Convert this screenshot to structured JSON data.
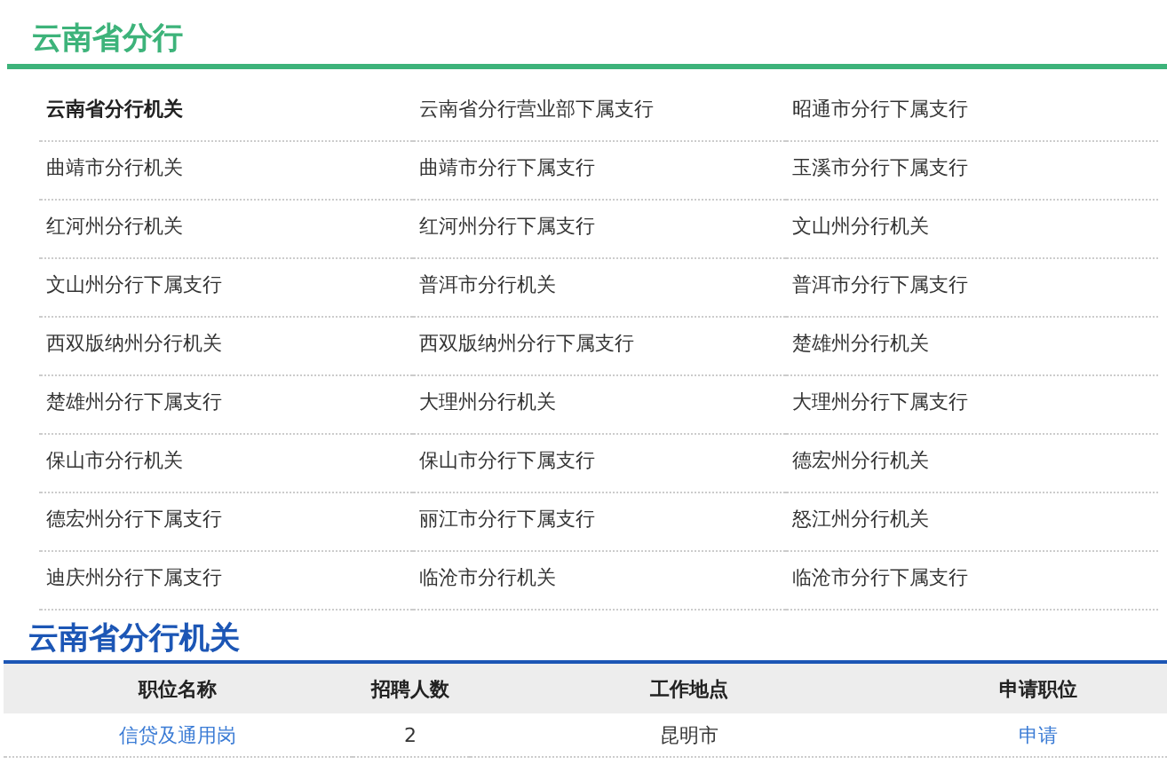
{
  "section": {
    "title": "云南省分行",
    "items": [
      {
        "label": "云南省分行机关",
        "selected": true
      },
      {
        "label": "云南省分行营业部下属支行",
        "selected": false
      },
      {
        "label": "昭通市分行下属支行",
        "selected": false
      },
      {
        "label": "曲靖市分行机关",
        "selected": false
      },
      {
        "label": "曲靖市分行下属支行",
        "selected": false
      },
      {
        "label": "玉溪市分行下属支行",
        "selected": false
      },
      {
        "label": "红河州分行机关",
        "selected": false
      },
      {
        "label": "红河州分行下属支行",
        "selected": false
      },
      {
        "label": "文山州分行机关",
        "selected": false
      },
      {
        "label": "文山州分行下属支行",
        "selected": false
      },
      {
        "label": "普洱市分行机关",
        "selected": false
      },
      {
        "label": "普洱市分行下属支行",
        "selected": false
      },
      {
        "label": "西双版纳州分行机关",
        "selected": false
      },
      {
        "label": "西双版纳州分行下属支行",
        "selected": false
      },
      {
        "label": "楚雄州分行机关",
        "selected": false
      },
      {
        "label": "楚雄州分行下属支行",
        "selected": false
      },
      {
        "label": "大理州分行机关",
        "selected": false
      },
      {
        "label": "大理州分行下属支行",
        "selected": false
      },
      {
        "label": "保山市分行机关",
        "selected": false
      },
      {
        "label": "保山市分行下属支行",
        "selected": false
      },
      {
        "label": "德宏州分行机关",
        "selected": false
      },
      {
        "label": "德宏州分行下属支行",
        "selected": false
      },
      {
        "label": "丽江市分行下属支行",
        "selected": false
      },
      {
        "label": "怒江州分行机关",
        "selected": false
      },
      {
        "label": "迪庆州分行下属支行",
        "selected": false
      },
      {
        "label": "临沧市分行机关",
        "selected": false
      },
      {
        "label": "临沧市分行下属支行",
        "selected": false
      }
    ]
  },
  "detail": {
    "title": "云南省分行机关",
    "table": {
      "columns": [
        "职位名称",
        "招聘人数",
        "工作地点",
        "申请职位"
      ],
      "rows": [
        {
          "position": "信贷及通用岗",
          "count": "2",
          "location": "昆明市",
          "apply": "申请"
        }
      ]
    }
  }
}
